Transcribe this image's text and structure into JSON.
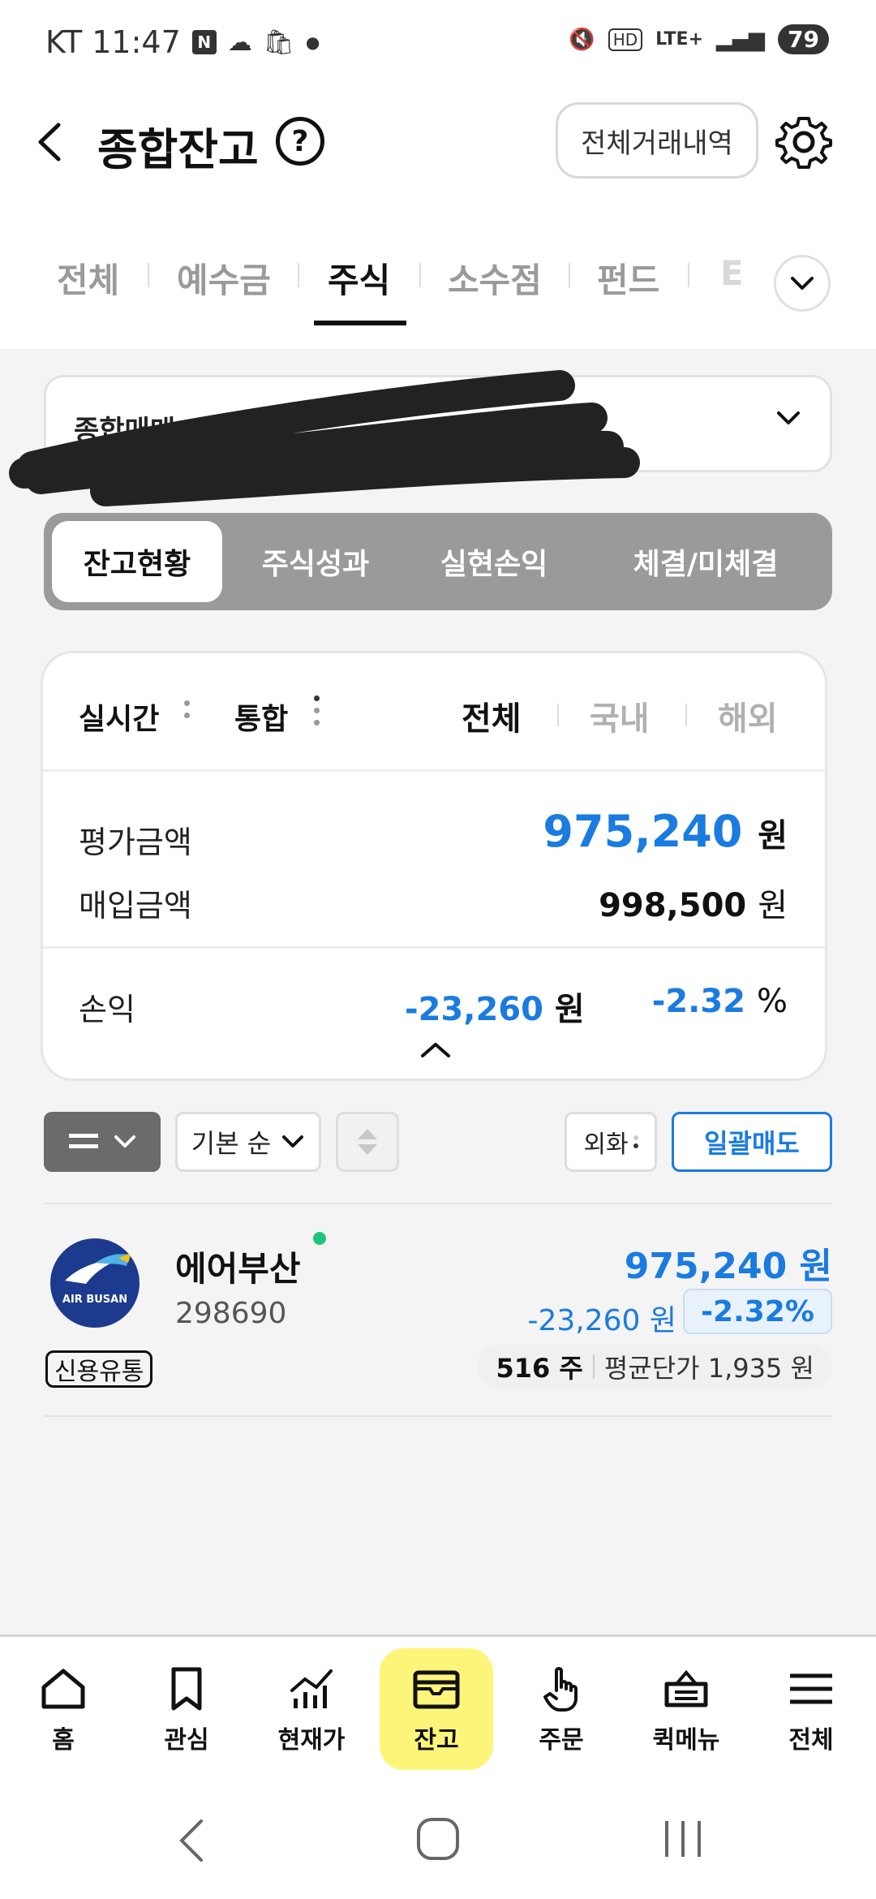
{
  "status_bar": {
    "carrier_time": "KT 11:47",
    "news_badge": "N",
    "battery": "79",
    "network": "LTE+"
  },
  "header": {
    "title": "종합잔고",
    "help": "?",
    "history_button": "전체거래내역"
  },
  "tabs": [
    {
      "label": "전체"
    },
    {
      "label": "예수금"
    },
    {
      "label": "주식"
    },
    {
      "label": "소수점"
    },
    {
      "label": "펀드"
    },
    {
      "label": "E"
    }
  ],
  "account": {
    "label": "종합매매"
  },
  "segment": [
    {
      "label": "잔고현황"
    },
    {
      "label": "주식성과"
    },
    {
      "label": "실현손익"
    },
    {
      "label": "체결/미체결"
    }
  ],
  "summary": {
    "mode": "실시간",
    "scope": "통합",
    "regions": [
      "전체",
      "국내",
      "해외"
    ],
    "eval_label": "평가금액",
    "eval_value": "975,240",
    "purchase_label": "매입금액",
    "purchase_value": "998,500",
    "pl_label": "손익",
    "pl_value": "-23,260",
    "pl_pct": "-2.32",
    "unit_won": "원",
    "unit_pct": "%"
  },
  "toolbar": {
    "sort_label": "기본 순",
    "fx_label": "외화",
    "sell_all": "일괄매도"
  },
  "holding": {
    "logo_text": "AIR BUSAN",
    "credit_badge": "신용유통",
    "name": "에어부산",
    "code": "298690",
    "value": "975,240 원",
    "pl": "-23,260 원",
    "pct": "-2.32%",
    "qty": "516 주",
    "avg_price": "평균단가 1,935 원"
  },
  "bottom_nav": [
    {
      "label": "홈",
      "icon": "home-icon"
    },
    {
      "label": "관심",
      "icon": "bookmark-icon"
    },
    {
      "label": "현재가",
      "icon": "chart-icon"
    },
    {
      "label": "잔고",
      "icon": "wallet-icon"
    },
    {
      "label": "주문",
      "icon": "hand-icon"
    },
    {
      "label": "퀵메뉴",
      "icon": "quick-menu-icon"
    },
    {
      "label": "전체",
      "icon": "menu-icon"
    }
  ],
  "colors": {
    "accent_blue": "#1a7be0",
    "active_nav": "#fdf57a",
    "segment_bg": "#9a9a9a"
  }
}
